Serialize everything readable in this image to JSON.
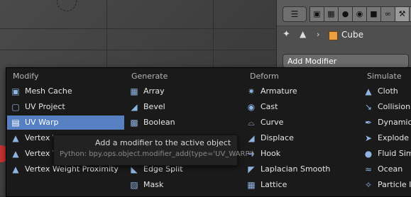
{
  "properties": {
    "toolbar": {
      "editor_type_icon": "properties-editor-icon",
      "context_tabs": [
        "render-icon",
        "render-layers-icon",
        "scene-icon",
        "world-icon",
        "object-icon",
        "constraints-icon",
        "modifiers-icon",
        "data-icon"
      ]
    },
    "object_name": "Cube",
    "add_modifier_label": "Add Modifier"
  },
  "menu": {
    "columns": [
      {
        "title": "Modify",
        "items": [
          {
            "label": "Mesh Cache",
            "icon": "mesh-cache-icon"
          },
          {
            "label": "UV Project",
            "icon": "uv-project-icon"
          },
          {
            "label": "UV Warp",
            "icon": "uv-warp-icon",
            "highlighted": true
          },
          {
            "label": "Vertex W",
            "icon": "vertex-weight-edit-icon"
          },
          {
            "label": "Vertex W",
            "icon": "vertex-weight-mix-icon"
          },
          {
            "label": "Vertex Weight Proximity",
            "icon": "vertex-weight-proximity-icon"
          }
        ]
      },
      {
        "title": "Generate",
        "items": [
          {
            "label": "Array",
            "icon": "array-icon"
          },
          {
            "label": "Bevel",
            "icon": "bevel-icon"
          },
          {
            "label": "Boolean",
            "icon": "boolean-icon"
          },
          {
            "label": "",
            "icon": "build-icon"
          },
          {
            "label": "",
            "icon": "decimate-icon"
          },
          {
            "label": "Edge Split",
            "icon": "edge-split-icon"
          },
          {
            "label": "Mask",
            "icon": "mask-icon"
          }
        ]
      },
      {
        "title": "Deform",
        "items": [
          {
            "label": "Armature",
            "icon": "armature-icon"
          },
          {
            "label": "Cast",
            "icon": "cast-icon"
          },
          {
            "label": "Curve",
            "icon": "curve-icon"
          },
          {
            "label": "Displace",
            "icon": "displace-icon"
          },
          {
            "label": "Hook",
            "icon": "hook-icon"
          },
          {
            "label": "Laplacian Smooth",
            "icon": "laplacian-smooth-icon"
          },
          {
            "label": "Lattice",
            "icon": "lattice-icon"
          }
        ]
      },
      {
        "title": "Simulate",
        "items": [
          {
            "label": "Cloth",
            "icon": "cloth-icon"
          },
          {
            "label": "Collision",
            "icon": "collision-icon"
          },
          {
            "label": "Dynamic",
            "icon": "dynamic-paint-icon"
          },
          {
            "label": "Explode",
            "icon": "explode-icon"
          },
          {
            "label": "Fluid Sim",
            "icon": "fluid-sim-icon"
          },
          {
            "label": "Ocean",
            "icon": "ocean-icon"
          },
          {
            "label": "Particle In",
            "icon": "particle-instance-icon"
          }
        ]
      }
    ]
  },
  "tooltip": {
    "description": "Add a modifier to the active object",
    "python": "Python: bpy.ops.object.modifier_add(type='UV_WARP')"
  },
  "colors": {
    "menu_bg": "#1a1a1a",
    "highlight": "#5680c2",
    "object_orange": "#e8a040"
  }
}
